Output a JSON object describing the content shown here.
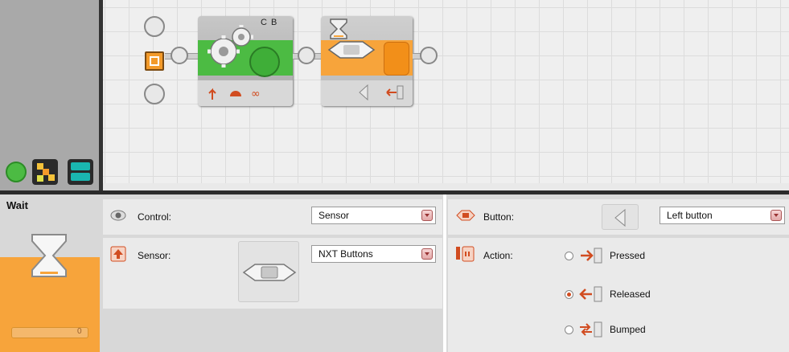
{
  "palette": {
    "tabs": [
      {
        "name": "common-palette",
        "icon": "green-circle-icon"
      },
      {
        "name": "complete-palette",
        "icon": "complete-palette-icon"
      },
      {
        "name": "custom-palette",
        "icon": "custom-palette-icon"
      }
    ]
  },
  "program": {
    "motor_block": {
      "ports": "C B",
      "icon": "gears-icon",
      "power_icon": "power-circle-icon"
    },
    "wait_block": {
      "icon": "hourglass-button-icon"
    }
  },
  "config": {
    "block_title": "Wait",
    "slider_value": "0",
    "control": {
      "label": "Control:",
      "value": "Sensor"
    },
    "sensor": {
      "label": "Sensor:",
      "value": "NXT Buttons"
    },
    "button": {
      "label": "Button:",
      "value": "Left button"
    },
    "action": {
      "label": "Action:",
      "options": [
        {
          "label": "Pressed",
          "selected": false
        },
        {
          "label": "Released",
          "selected": true
        },
        {
          "label": "Bumped",
          "selected": false
        }
      ]
    }
  },
  "colors": {
    "orange": "#f7a43b",
    "green": "#4cbb43",
    "red_icon": "#d14c20"
  }
}
